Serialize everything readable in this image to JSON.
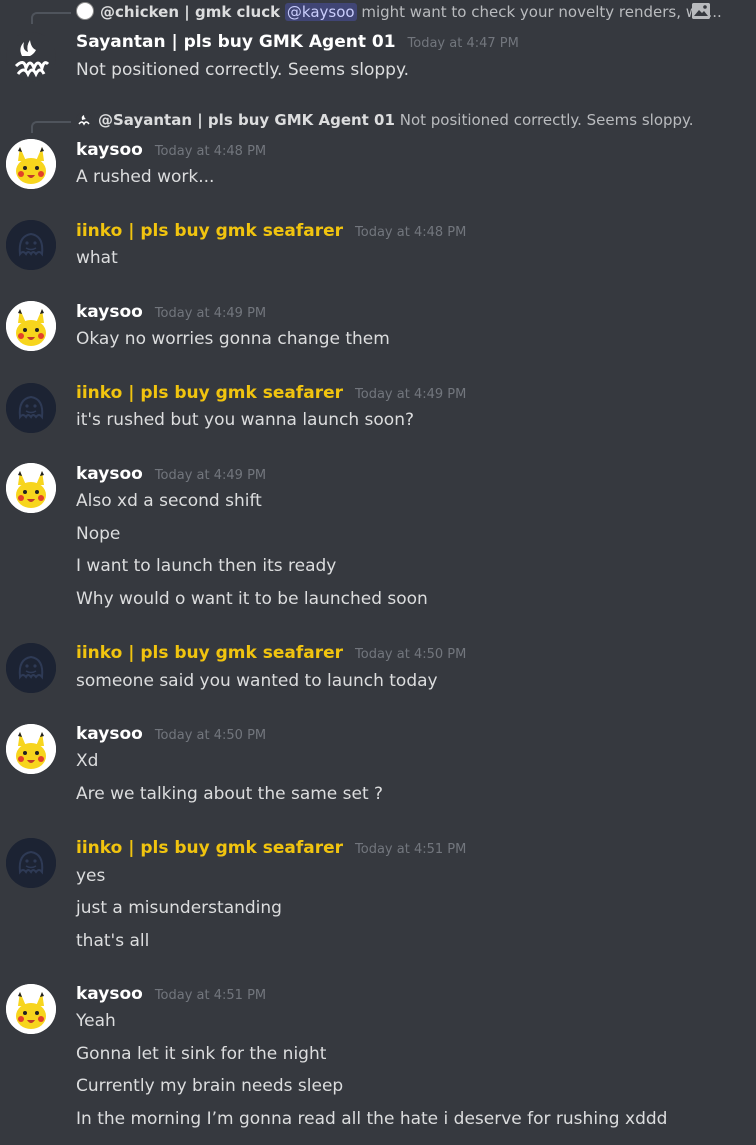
{
  "reply1": {
    "name": "@chicken | gmk cluck",
    "mention": "@kaysoo",
    "text": "might want to check your novelty renders, wh..."
  },
  "msg_sayantan": {
    "name": "Sayantan | pls buy GMK Agent 01",
    "time": "Today at 4:47 PM",
    "lines": [
      "Not positioned correctly. Seems sloppy."
    ]
  },
  "reply2": {
    "name": "@Sayantan | pls buy GMK Agent 01",
    "text": "Not positioned correctly. Seems sloppy."
  },
  "messages": [
    {
      "author": "kaysoo",
      "time": "Today at 4:48 PM",
      "lines": [
        "A rushed work..."
      ]
    },
    {
      "author": "iinko | pls buy gmk seafarer",
      "time": "Today at 4:48 PM",
      "lines": [
        "what"
      ]
    },
    {
      "author": "kaysoo",
      "time": "Today at 4:49 PM",
      "lines": [
        "Okay no worries gonna change them"
      ]
    },
    {
      "author": "iinko | pls buy gmk seafarer",
      "time": "Today at 4:49 PM",
      "lines": [
        "it's rushed but you wanna launch soon?"
      ]
    },
    {
      "author": "kaysoo",
      "time": "Today at 4:49 PM",
      "lines": [
        "Also xd a second shift",
        "Nope",
        "I want to launch then its ready",
        "Why would o want it to be launched soon"
      ]
    },
    {
      "author": "iinko | pls buy gmk seafarer",
      "time": "Today at 4:50 PM",
      "lines": [
        "someone said you wanted to launch today"
      ]
    },
    {
      "author": "kaysoo",
      "time": "Today at 4:50 PM",
      "lines": [
        "Xd",
        "Are we talking about the same set ?"
      ]
    },
    {
      "author": "iinko | pls buy gmk seafarer",
      "time": "Today at 4:51 PM",
      "lines": [
        "yes",
        "just a misunderstanding",
        "that's all"
      ]
    },
    {
      "author": "kaysoo",
      "time": "Today at 4:51 PM",
      "lines": [
        "Yeah",
        "Gonna let it sink for the night",
        "Currently my brain needs sleep",
        "In the morning I’m gonna read all the hate i deserve for rushing xddd"
      ]
    }
  ],
  "colors": {
    "background": "#36393f",
    "iinko_name": "#f1c40f",
    "timestamp": "#72767d"
  },
  "icons": {
    "reply_attachment": "image-icon",
    "kaysoo_avatar": "pikachu-avatar",
    "iinko_avatar": "smiley-ghost-avatar",
    "sayantan_avatar": "flame-logo-avatar"
  }
}
